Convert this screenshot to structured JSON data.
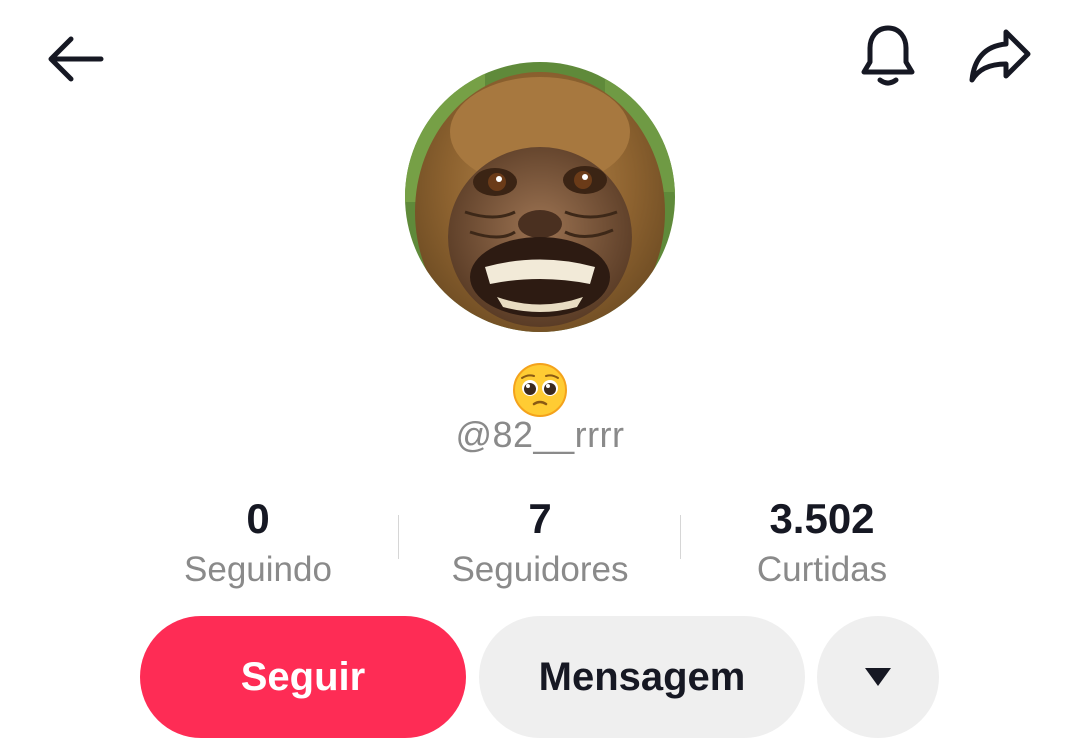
{
  "header": {
    "back_icon": "arrow-left-icon",
    "notify_icon": "bell-icon",
    "share_icon": "share-arrow-icon"
  },
  "profile": {
    "avatar_icon": "monkey-avatar",
    "nickname": "🥺",
    "username": "@82__rrrr"
  },
  "stats": [
    {
      "value": "0",
      "label": "Seguindo"
    },
    {
      "value": "7",
      "label": "Seguidores"
    },
    {
      "value": "3.502",
      "label": "Curtidas"
    }
  ],
  "actions": {
    "follow_label": "Seguir",
    "message_label": "Mensagem",
    "more_icon": "caret-down-icon"
  },
  "colors": {
    "follow_button": "#fe2c55",
    "secondary_button": "#efefef",
    "text_primary": "#161823",
    "text_secondary": "#8a8a8a"
  }
}
